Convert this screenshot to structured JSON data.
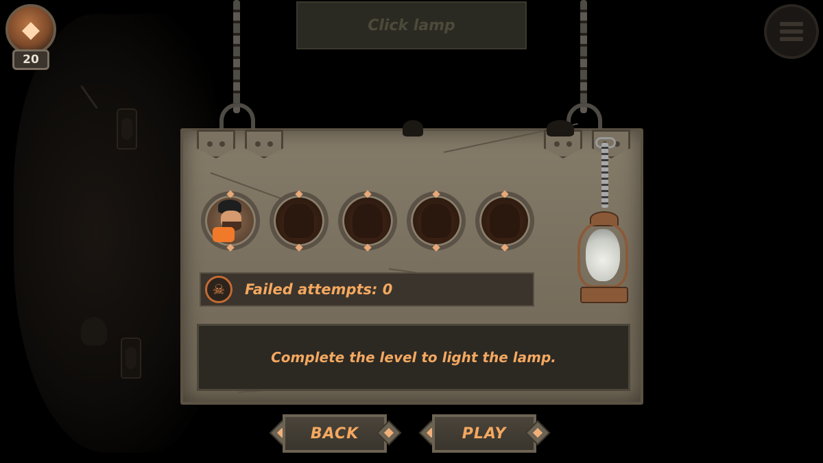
{
  "hud": {
    "gem_count": "20",
    "hint": "Click lamp"
  },
  "board": {
    "failed_attempts": "Failed attempts: 0",
    "description": "Complete the level to light the lamp."
  },
  "buttons": {
    "back": "BACK",
    "play": "PLAY"
  },
  "portraits": [
    {
      "state": "unlocked"
    },
    {
      "state": "locked"
    },
    {
      "state": "locked"
    },
    {
      "state": "locked"
    },
    {
      "state": "locked"
    }
  ],
  "colors": {
    "accent_text": "#f4a860",
    "board": "#7a705f"
  }
}
